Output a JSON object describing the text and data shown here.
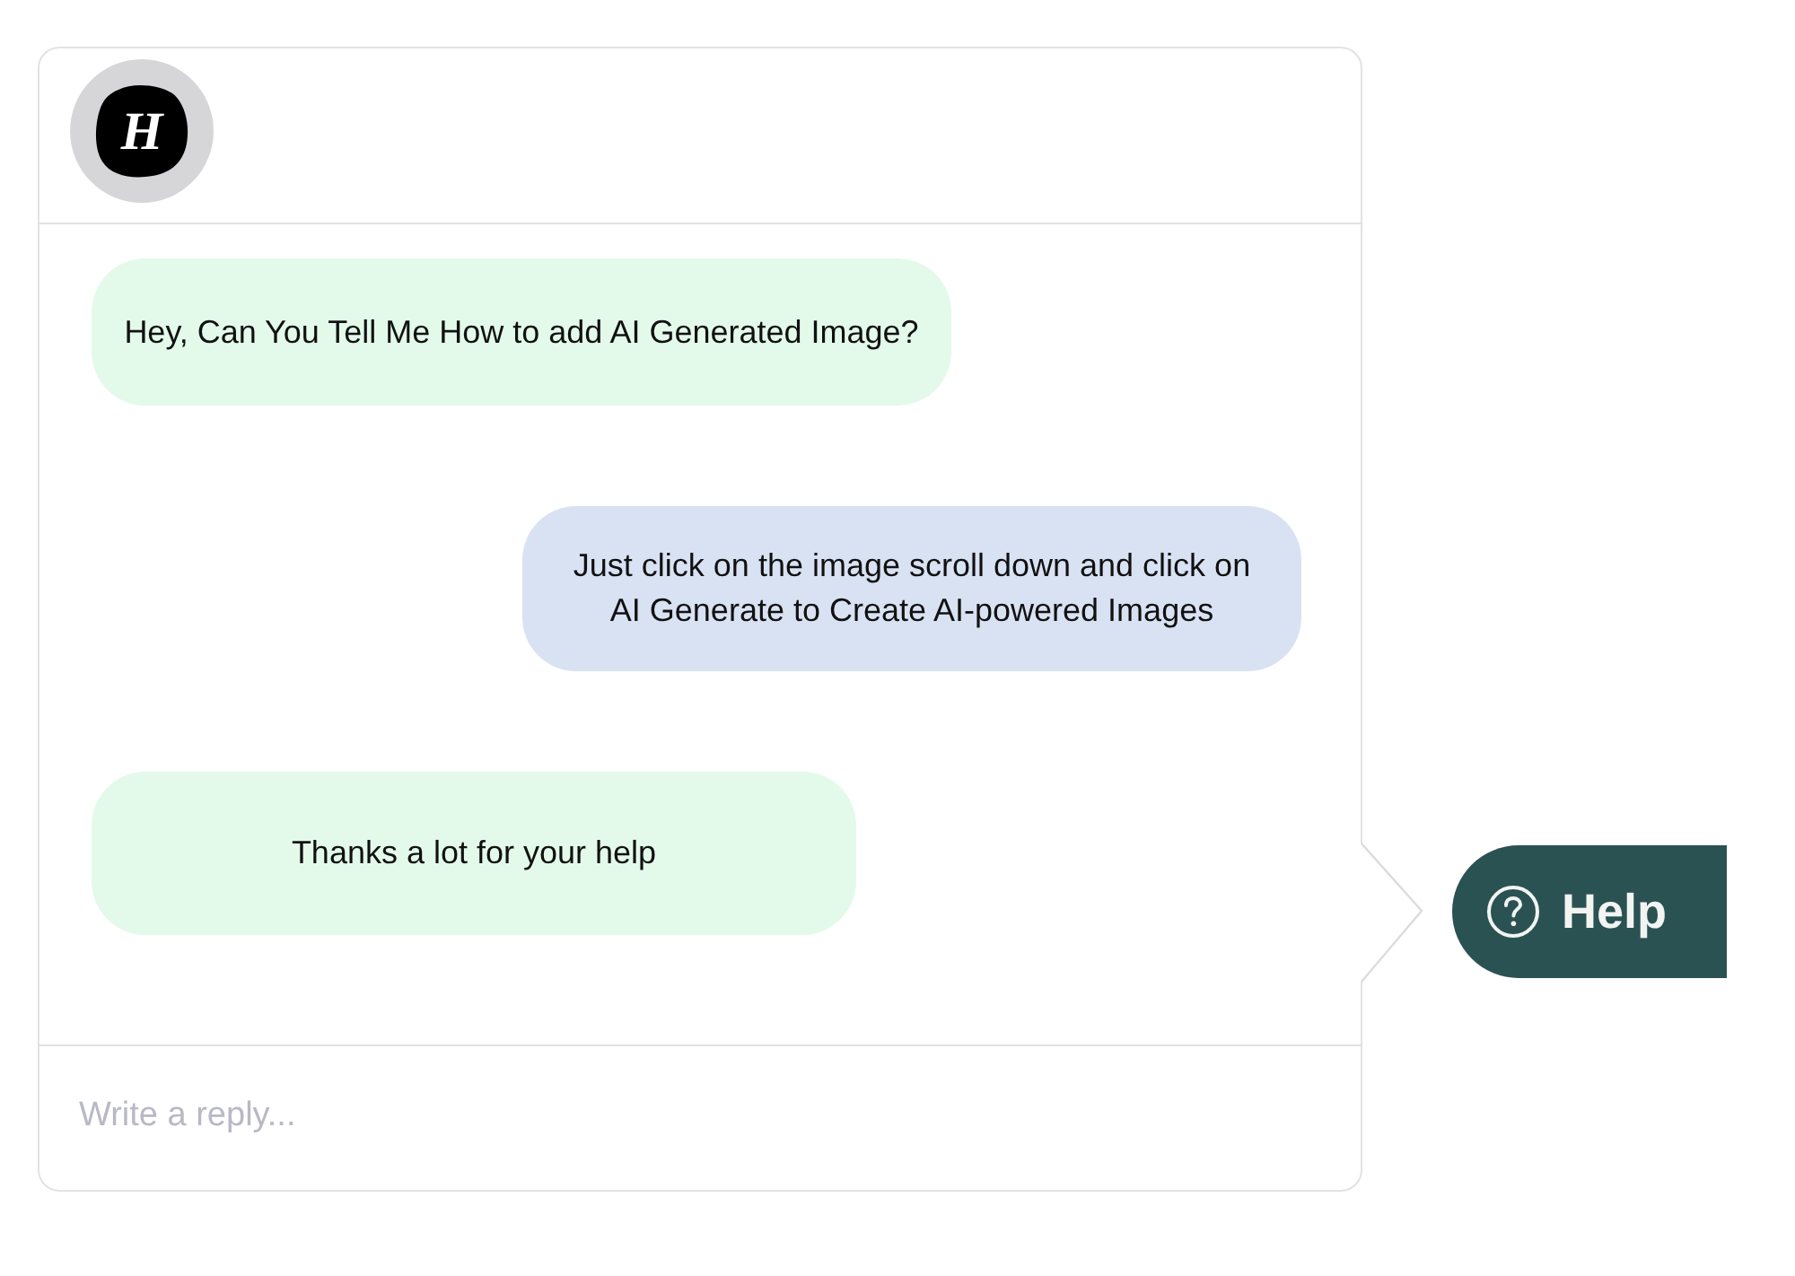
{
  "header": {
    "logo_letter": "H"
  },
  "messages": [
    {
      "kind": "user",
      "text": "Hey, Can You Tell Me How to add AI Generated Image?"
    },
    {
      "kind": "agent",
      "text": "Just click on the image scroll down and click on AI Generate to Create AI-powered Images"
    },
    {
      "kind": "user",
      "text": "Thanks a lot for your help"
    }
  ],
  "reply": {
    "placeholder": "Write a reply..."
  },
  "help_button": {
    "label": "Help"
  }
}
